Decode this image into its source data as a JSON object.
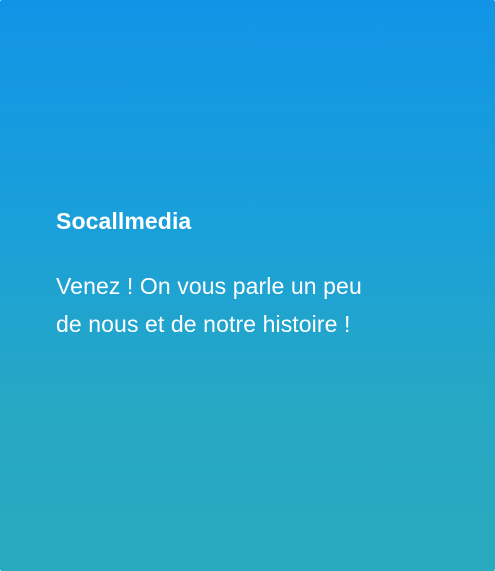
{
  "card": {
    "title": "Socallmedia",
    "description": "Venez ! On vous parle un peu de nous et de notre histoire !"
  },
  "colors": {
    "gradient_top": "#1294e6",
    "gradient_bottom": "#2aaabf",
    "text": "#ffffff"
  }
}
